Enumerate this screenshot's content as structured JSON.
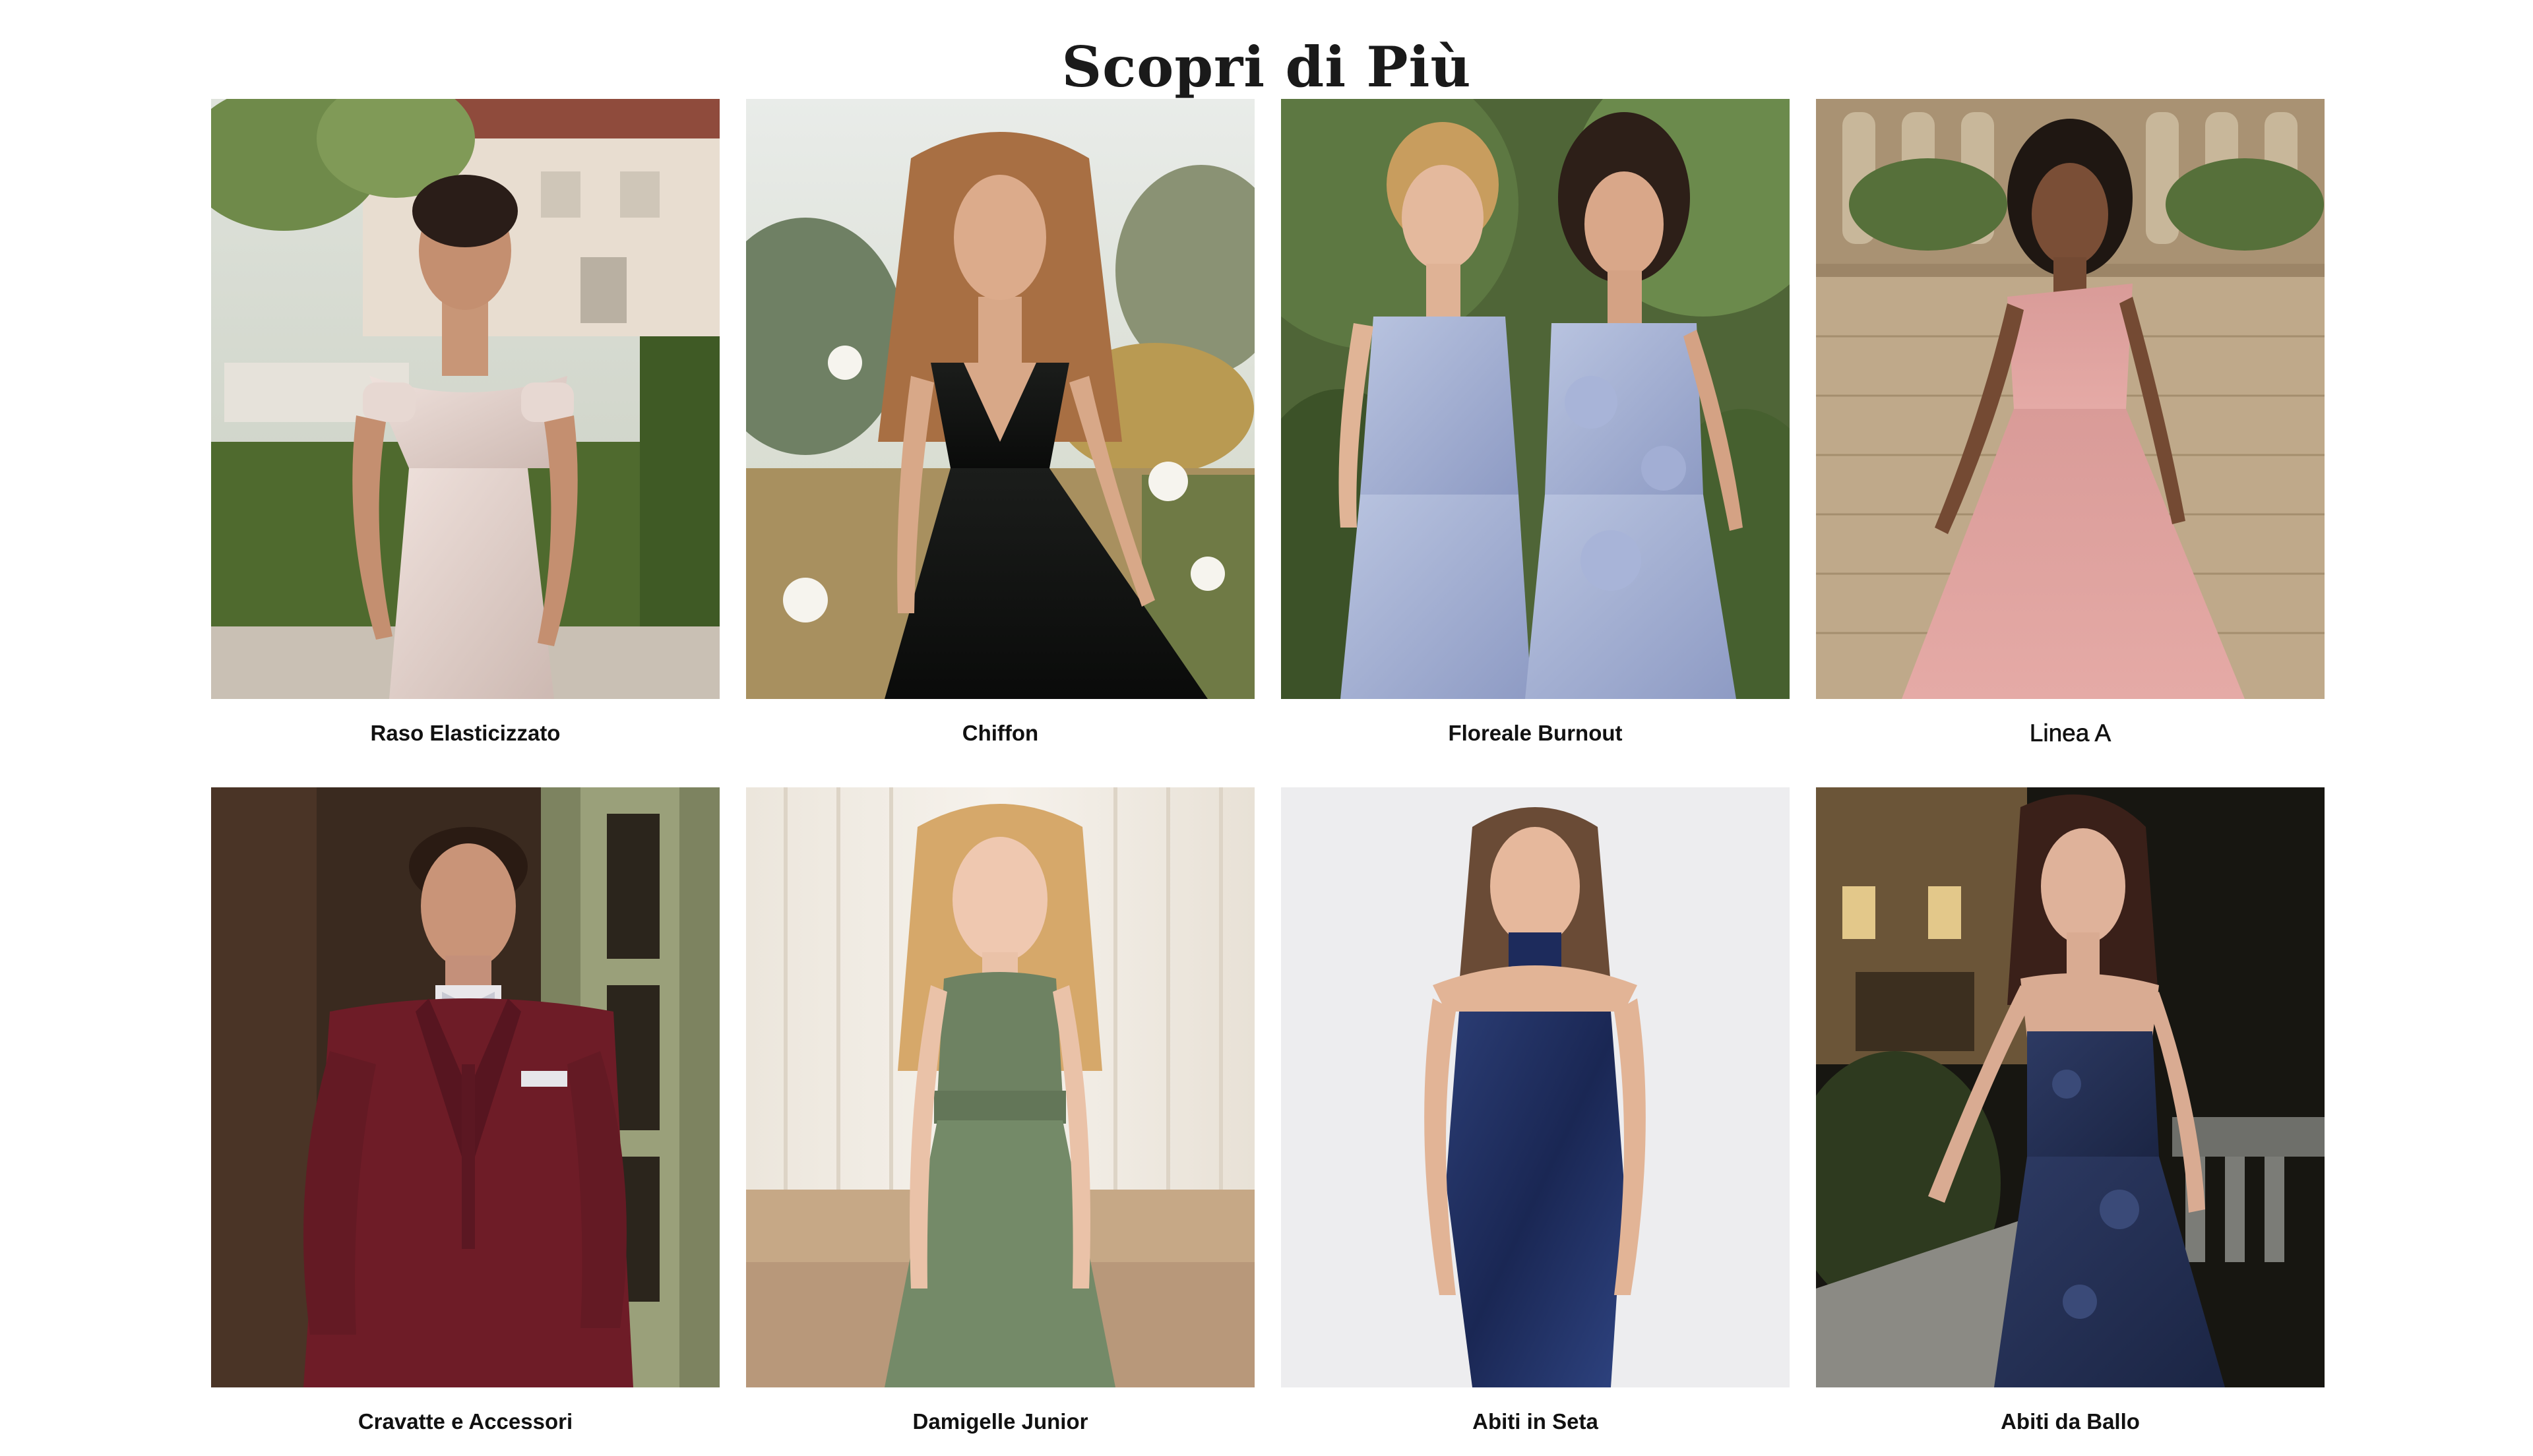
{
  "page": {
    "title": "Scopri di Più"
  },
  "categories": [
    {
      "label": "Raso Elasticizzato",
      "image": "model in blush off-shoulder stretch satin gown in garden"
    },
    {
      "label": "Chiffon",
      "image": "model in black pleated chiffon v-neck gown with white roses"
    },
    {
      "label": "Floreale Burnout",
      "image": "two models in light blue dresses"
    },
    {
      "label": "Linea A",
      "image": "model in pink one-shoulder a-line gown by stone balustrade"
    },
    {
      "label": "Cravatte e Accessori",
      "image": "man in burgundy suit with light grey bow tie"
    },
    {
      "label": "Damigelle Junior",
      "image": "girl in sage green chiffon halter dress"
    },
    {
      "label": "Abiti in Seta",
      "image": "model in navy strapless satin gown with neck scarf"
    },
    {
      "label": "Abiti da Ballo",
      "image": "model in navy lace gown at night on terrace"
    }
  ],
  "colors": {
    "background": "#ffffff",
    "text": "#111111"
  }
}
